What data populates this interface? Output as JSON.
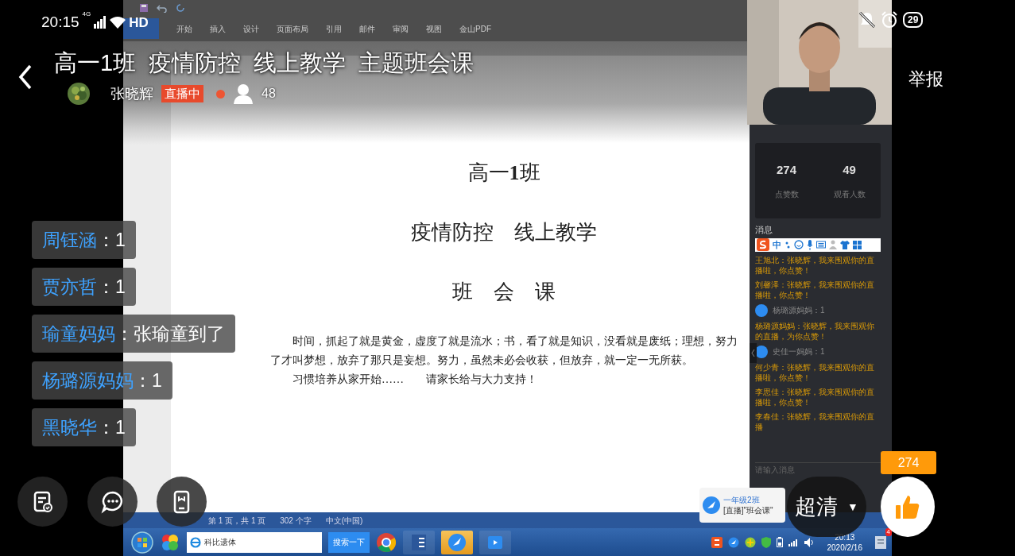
{
  "status_bar": {
    "time": "20:15",
    "network": "4G",
    "quality": "HD",
    "battery": "29"
  },
  "header": {
    "title": "高一1班  疫情防控  线上教学  主题班会课",
    "streamer": "张晓辉",
    "live_badge": "直播中",
    "viewers": "48",
    "report": "举报"
  },
  "shared_screen": {
    "ribbon_tabs": [
      "开始",
      "插入",
      "设计",
      "页面布局",
      "引用",
      "邮件",
      "审阅",
      "视图",
      "金山PDF"
    ],
    "document": {
      "heading": "高一**1**班",
      "subheading": "疫情防控　线上教学",
      "section": "班　会　课",
      "paragraphs": [
        "时间，抓起了就是黄金，虚度了就是流水；书，看了就是知识，没看就是废纸；理想，努力了才叫梦想，放弃了那只是妄想。努力，虽然未必会收获，但放弃，就一定一无所获。",
        "习惯培养从家开始……　　请家长给与大力支持！"
      ]
    },
    "live_panel": {
      "stats": [
        {
          "value": "274",
          "label": "点赞数"
        },
        {
          "value": "49",
          "label": "观看人数"
        }
      ],
      "messages_title": "消息",
      "ime_mode": "中",
      "messages": [
        {
          "kind": "text",
          "text": "王旭北：张晓辉，我来围观你的直播啦，你点赞！"
        },
        {
          "kind": "text",
          "text": "刘馨泽：张晓辉，我来围观你的直播啦，你点赞！"
        },
        {
          "kind": "avatar",
          "text": "杨璐源妈妈：1"
        },
        {
          "kind": "text",
          "text": "杨璐源妈妈：张晓辉，我来围观你的直播，为你点赞！"
        },
        {
          "kind": "avatar",
          "text": "史佳一妈妈：1"
        },
        {
          "kind": "text",
          "text": "何少青：张晓辉，我来围观你的直播啦，你点赞！"
        },
        {
          "kind": "text",
          "text": "李思佳：张晓辉，我来围观你的直播啦，你点赞！"
        },
        {
          "kind": "text",
          "text": "李春佳：张晓辉，我来围观你的直播"
        }
      ],
      "input": {
        "placeholder": "请输入消息"
      }
    },
    "word_status": [
      "第 1 页，共 1 页",
      "302 个字",
      "中文(中国)"
    ],
    "taskbar": {
      "search_value": "科比遗体",
      "search_button": "搜索一下",
      "clock_time": "20:13",
      "clock_date": "2020/2/16",
      "notification_count": "4"
    },
    "tray_tooltip": {
      "title": "一年级2班",
      "text": "[直播]\"班会课\""
    }
  },
  "chat": [
    {
      "name": "周钰涵",
      "text": "：1"
    },
    {
      "name": "贾亦哲",
      "text": "：1"
    },
    {
      "name": "瑜童妈妈",
      "text": "：张瑜童到了"
    },
    {
      "name": "杨璐源妈妈",
      "text": "：1"
    },
    {
      "name": "黑晓华",
      "text": "：1"
    }
  ],
  "like": {
    "count": "274"
  },
  "quality": {
    "label": "超清",
    "arrow": "▼"
  }
}
